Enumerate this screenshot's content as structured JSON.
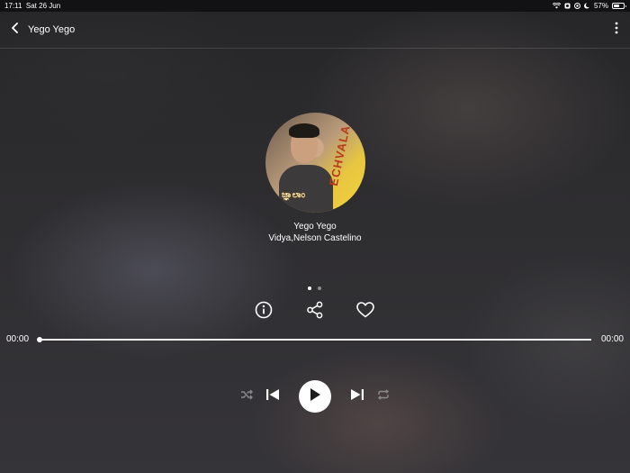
{
  "status_bar": {
    "time": "17:11",
    "date": "Sat 26 Jun",
    "battery_percent": "57%",
    "battery_level": 0.57,
    "icons": [
      "wifi-icon",
      "alarm-icon",
      "location-icon",
      "moon-icon",
      "battery-icon"
    ]
  },
  "header": {
    "title": "Yego Yego",
    "back_icon": "chevron-left-icon",
    "more_icon": "more-vertical-icon"
  },
  "now_playing": {
    "song_title": "Yego Yego",
    "artist": "Vidya,Nelson Castelino",
    "album_art_text": "ECHVALA",
    "album_art_caption": "ಜ್ಞಾಲಾಂ"
  },
  "pager": {
    "count": 2,
    "active_index": 0
  },
  "actions": [
    {
      "name": "info-button",
      "icon": "info-icon"
    },
    {
      "name": "share-button",
      "icon": "share-icon"
    },
    {
      "name": "favorite-button",
      "icon": "heart-icon"
    }
  ],
  "progress": {
    "elapsed": "00:00",
    "total": "00:00",
    "fraction": 0
  },
  "controls": {
    "shuffle_icon": "shuffle-icon",
    "previous_icon": "skip-previous-icon",
    "play_icon": "play-icon",
    "next_icon": "skip-next-icon",
    "repeat_icon": "repeat-icon"
  }
}
